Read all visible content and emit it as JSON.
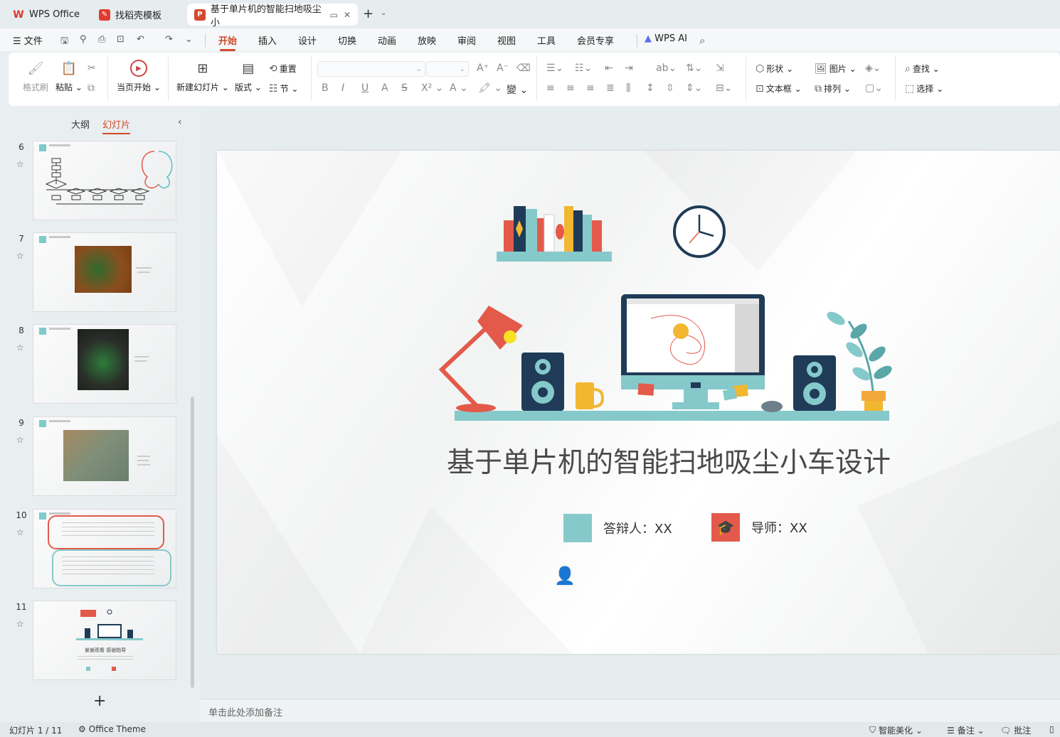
{
  "tabs": [
    {
      "label": "WPS Office",
      "icon": "wps-logo-icon"
    },
    {
      "label": "找稻壳模板",
      "icon": "docer-icon"
    },
    {
      "label": "基于单片机的智能扫地吸尘小",
      "icon": "presentation-icon",
      "active": true
    }
  ],
  "menu": {
    "file": "文件",
    "items": [
      "开始",
      "插入",
      "设计",
      "切换",
      "动画",
      "放映",
      "审阅",
      "视图",
      "工具",
      "会员专享"
    ],
    "active": "开始",
    "ai": "WPS AI"
  },
  "ribbon": {
    "format_painter": "格式刷",
    "paste": "粘贴",
    "start_from_current": "当页开始",
    "new_slide": "新建幻灯片",
    "layout": "版式",
    "reset": "重置",
    "section": "节",
    "shape": "形状",
    "picture": "图片",
    "textbox": "文本框",
    "arrange": "排列",
    "find": "查找",
    "select": "选择"
  },
  "left_panel": {
    "tab_outline": "大纲",
    "tab_slides": "幻灯片",
    "thumbnails": [
      {
        "num": "6"
      },
      {
        "num": "7"
      },
      {
        "num": "8"
      },
      {
        "num": "9"
      },
      {
        "num": "10"
      },
      {
        "num": "11",
        "title": "谢谢观看 感谢指导"
      }
    ]
  },
  "slide": {
    "title": "基于单片机的智能扫地吸尘小车设计",
    "presenter": "答辩人：XX",
    "advisor": "导师：XX",
    "colors": {
      "teal": "#86c9cb",
      "red": "#e35a4a",
      "navy": "#1f3b57"
    }
  },
  "notes_placeholder": "单击此处添加备注",
  "status": {
    "slide_counter": "幻灯片 1 / 11",
    "theme": "Office Theme",
    "beautify": "智能美化",
    "notes": "备注",
    "comments": "批注"
  }
}
